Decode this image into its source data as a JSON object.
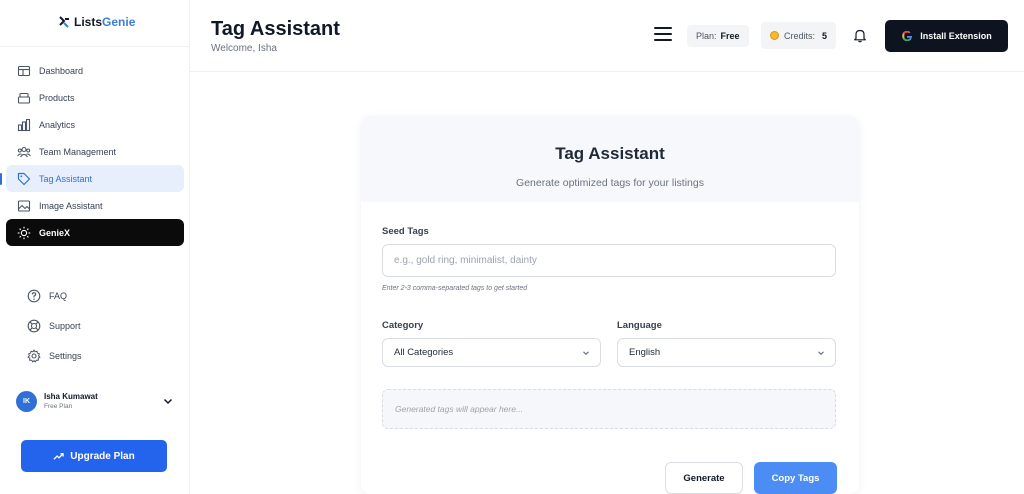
{
  "brand": {
    "prefix": "Lists",
    "suffix": "Genie"
  },
  "sidebar": {
    "items": [
      {
        "label": "Dashboard",
        "icon": "dashboard-icon"
      },
      {
        "label": "Products",
        "icon": "products-box-icon"
      },
      {
        "label": "Analytics",
        "icon": "bar-chart-icon"
      },
      {
        "label": "Team Management",
        "icon": "team-users-icon"
      },
      {
        "label": "Tag Assistant",
        "icon": "tag-icon",
        "active": true
      },
      {
        "label": "Image Assistant",
        "icon": "image-icon"
      },
      {
        "label": "GenieX",
        "icon": "lightbulb-icon",
        "highlight": true
      }
    ],
    "bottom": [
      {
        "label": "FAQ",
        "icon": "question-circle-icon"
      },
      {
        "label": "Support",
        "icon": "lifebuoy-icon"
      },
      {
        "label": "Settings",
        "icon": "gear-icon"
      }
    ],
    "user": {
      "initials": "IK",
      "name": "Isha Kumawat",
      "plan": "Free Plan"
    },
    "upgrade_label": "Upgrade Plan"
  },
  "header": {
    "title": "Tag Assistant",
    "welcome": "Welcome, Isha",
    "plan_label": "Plan:",
    "plan_value": "Free",
    "credits_label": "Credits:",
    "credits_value": "5",
    "install_label": "Install Extension"
  },
  "card": {
    "title": "Tag Assistant",
    "subtitle": "Generate optimized tags for your listings",
    "seed_label": "Seed Tags",
    "seed_value": "",
    "seed_placeholder": "e.g., gold ring, minimalist, dainty",
    "seed_hint": "Enter 2-3 comma-separated tags to get started",
    "category_label": "Category",
    "category_value": "All Categories",
    "language_label": "Language",
    "language_value": "English",
    "output_placeholder": "Generated tags will appear here...",
    "generate_label": "Generate",
    "copy_label": "Copy Tags"
  },
  "colors": {
    "accent": "#2463eb",
    "active_bg": "#e8effc",
    "dark": "#0e1320",
    "copy_button": "#4c8df5"
  }
}
